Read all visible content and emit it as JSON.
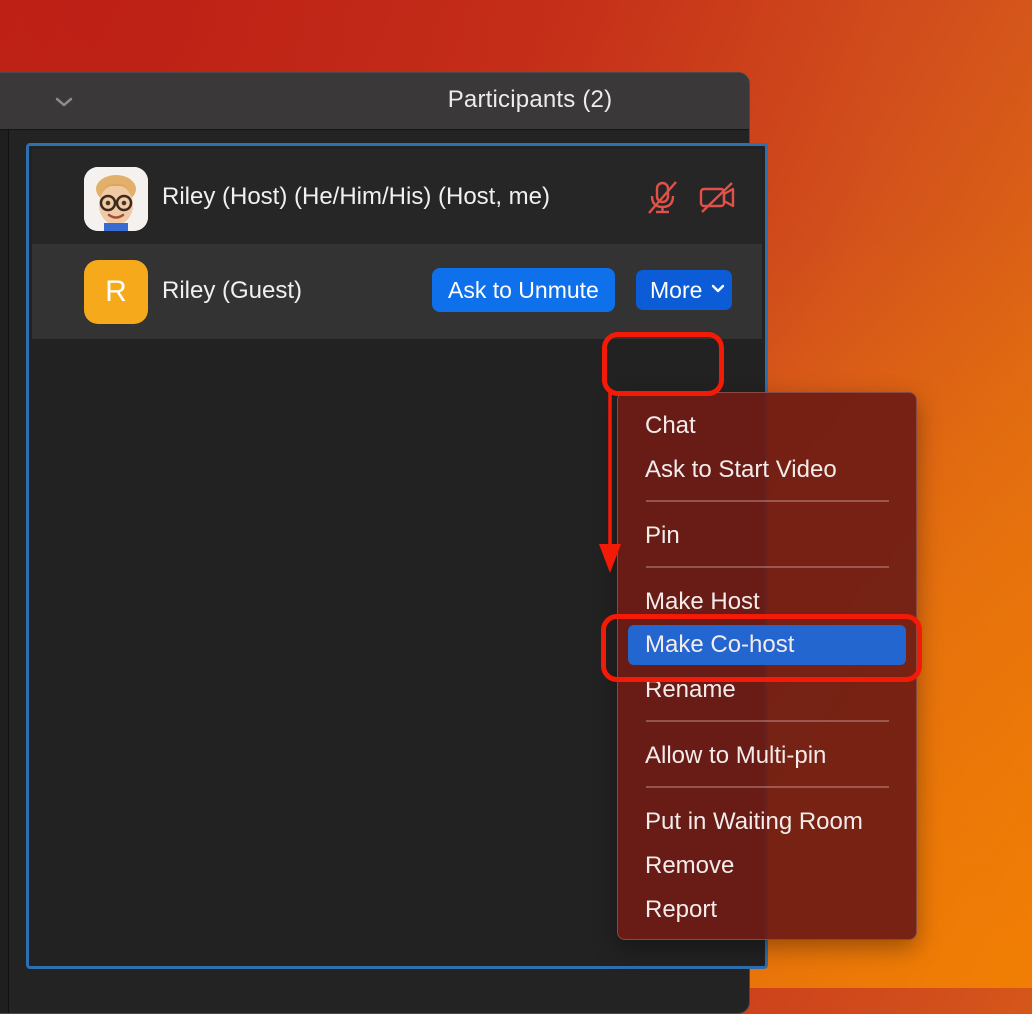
{
  "panel": {
    "title": "Participants (2)"
  },
  "participants": [
    {
      "name": "Riley (Host) (He/Him/His) (Host, me)",
      "avatar_icon": "memoji-avatar",
      "mic_status_icon": "mic-muted-icon",
      "video_status_icon": "video-off-icon",
      "status_color": "#e0514a"
    },
    {
      "name": "Riley (Guest)",
      "avatar_initial": "R",
      "avatar_color": "#f6a91b",
      "ask_unmute_label": "Ask to Unmute",
      "more_label": "More"
    }
  ],
  "context_menu": {
    "items": [
      "Chat",
      "Ask to Start Video",
      "Pin",
      "Make Host",
      "Make Co-host",
      "Rename",
      "Allow to Multi-pin",
      "Put in Waiting Room",
      "Remove",
      "Report"
    ],
    "selected": "Make Co-host"
  },
  "annotation_color": "#f31a07",
  "accent_color": "#0e71eb"
}
